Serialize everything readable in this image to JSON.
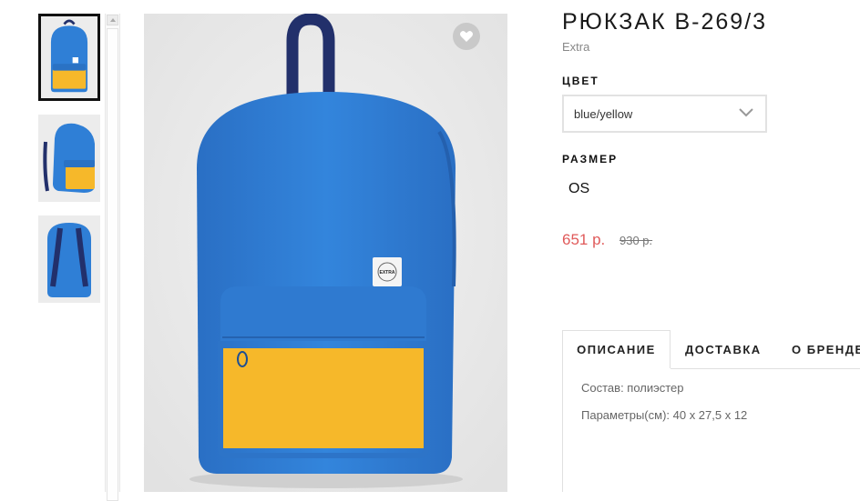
{
  "product": {
    "title": "РЮКЗАК B-269/3",
    "brand": "Extra",
    "color_label": "ЦВЕТ",
    "color_value": "blue/yellow",
    "size_label": "РАЗМЕР",
    "size_value": "OS",
    "price": "651 р.",
    "old_price": "930 р.",
    "patch_text": "EXTRA"
  },
  "tabs": [
    {
      "label": "ОПИСАНИЕ",
      "active": true
    },
    {
      "label": "ДОСТАВКА",
      "active": false
    },
    {
      "label": "О БРЕНДЕ",
      "active": false
    }
  ],
  "description": {
    "composition": "Состав: полиэстер",
    "params": "Параметры(см): 40 х 27,5 х 12"
  },
  "icons": {
    "favorite": "heart-icon",
    "select": "chevron-down-icon",
    "scroll": "scroll-up-arrow-icon"
  },
  "colors": {
    "bag_blue": "#2f7fd6",
    "bag_yellow": "#f6b82a",
    "strap_navy": "#22306b",
    "price_red": "#e05a5a"
  }
}
